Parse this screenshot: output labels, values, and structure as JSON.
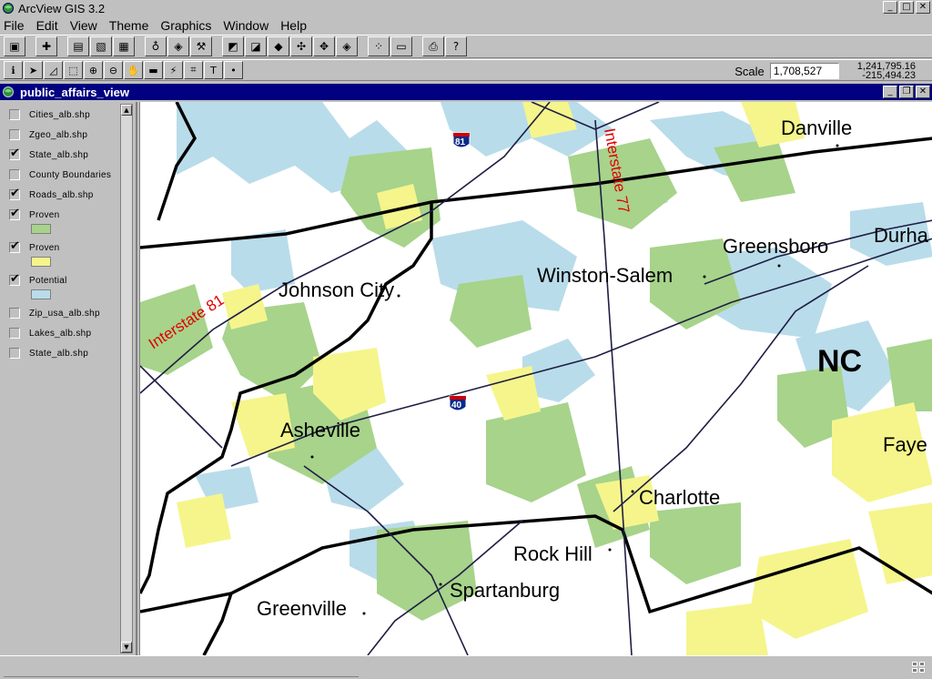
{
  "window": {
    "title": "ArcView GIS 3.2"
  },
  "menu": [
    "File",
    "Edit",
    "View",
    "Theme",
    "Graphics",
    "Window",
    "Help"
  ],
  "toolbar1": [
    "save-icon",
    "add-theme-icon",
    "theme-properties-icon",
    "edit-legend-icon",
    "open-table-icon",
    "find-icon",
    "locate-address-icon",
    "query-builder-icon",
    "zoom-full-icon",
    "zoom-active-icon",
    "zoom-selected-icon",
    "zoom-in-fixed-icon",
    "zoom-out-fixed-icon",
    "zoom-previous-icon",
    "select-features-icon",
    "clear-selected-icon",
    "print-icon",
    "help-icon"
  ],
  "toolbar2": [
    "identify-icon",
    "pointer-icon",
    "vertex-edit-icon",
    "select-feature-icon",
    "zoom-in-icon",
    "zoom-out-icon",
    "pan-icon",
    "measure-icon",
    "hotlink-icon",
    "label-icon",
    "text-tool-icon",
    "draw-point-icon"
  ],
  "scale": {
    "label": "Scale",
    "value": "1,708,527"
  },
  "coords": {
    "x": "1,241,795.16",
    "y": "-215,494.23"
  },
  "view": {
    "title": "public_affairs_view"
  },
  "legend": [
    {
      "label": "Cities_alb.shp",
      "checked": false
    },
    {
      "label": "Zgeo_alb.shp",
      "checked": false
    },
    {
      "label": "State_alb.shp",
      "checked": true
    },
    {
      "label": "County Boundaries",
      "checked": false
    },
    {
      "label": "Roads_alb.shp",
      "checked": true
    },
    {
      "label": "Proven",
      "checked": true,
      "swatch": "#a7d38b"
    },
    {
      "label": "Proven",
      "checked": true,
      "swatch": "#f5f58c"
    },
    {
      "label": "Potential",
      "checked": true,
      "swatch": "#b9dcea"
    },
    {
      "label": "Zip_usa_alb.shp",
      "checked": false
    },
    {
      "label": "Lakes_alb.shp",
      "checked": false
    },
    {
      "label": "State_alb.shp",
      "checked": false
    }
  ],
  "map": {
    "colors": {
      "green": "#a7d38b",
      "yellow": "#f5f58c",
      "blue": "#b9dcea"
    },
    "cities": [
      "Danville",
      "Greensboro",
      "Durha",
      "Winston-Salem",
      "Johnson City",
      "Asheville",
      "Charlotte",
      "Rock Hill",
      "Spartanburg",
      "Greenville",
      "Faye"
    ],
    "state_label": "NC",
    "roads": [
      "Interstate 81",
      "Interstate 77"
    ],
    "shields": [
      "81",
      "40"
    ]
  }
}
